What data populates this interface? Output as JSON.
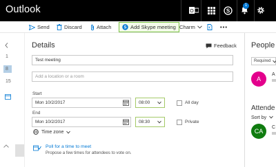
{
  "app": {
    "title": "Outlook"
  },
  "topbar": {
    "notification_count": "1"
  },
  "toolbar": {
    "send": "Send",
    "discard": "Discard",
    "attach": "Attach",
    "skype": "Add Skype meeting",
    "charm": "Charm"
  },
  "leftpane": {
    "numbers": [
      "1",
      "8",
      "15"
    ]
  },
  "details": {
    "title": "Details",
    "feedback": "Feedback",
    "subject_value": "Test meeting",
    "location_placeholder": "Add a location or a room",
    "start_label": "Start",
    "start_date": "Mon 10/2/2017",
    "start_time": "08:00",
    "allday_label": "All day",
    "end_label": "End",
    "end_date": "Mon 10/2/2017",
    "end_time": "08:30",
    "private_label": "Private",
    "timezone_label": "Time zone",
    "poll_title": "Poll for a time to meet",
    "poll_subtitle": "Propose a few times for attendees to vote on."
  },
  "people": {
    "title": "People",
    "required_label": "Required",
    "avatar1_initial": "A",
    "avatar1_peek": "A",
    "attendees_title": "Attende",
    "sortby_label": "Sort by",
    "avatar2_initials": "CA",
    "avatar2_peek": "C"
  },
  "colors": {
    "accent": "#0078d4",
    "skype_border": "#7ac142",
    "avatar1": "#e3008c",
    "avatar2": "#107c10"
  }
}
